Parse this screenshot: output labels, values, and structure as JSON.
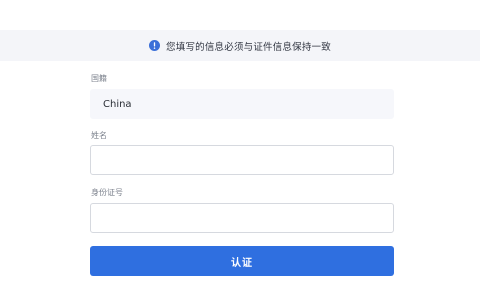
{
  "notice": {
    "icon": "exclamation-circle-icon",
    "text": "您填写的信息必须与证件信息保持一致",
    "accent": "#3b6fd8"
  },
  "form": {
    "nationality": {
      "label": "国籍",
      "value": "China",
      "disabled": true
    },
    "name": {
      "label": "姓名",
      "value": ""
    },
    "id_number": {
      "label": "身份证号",
      "value": ""
    },
    "submit": {
      "label": "认证",
      "color": "#2f6fe0"
    }
  }
}
